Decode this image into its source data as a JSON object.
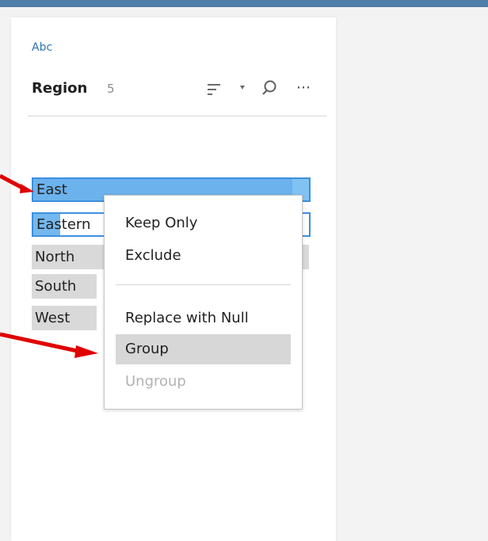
{
  "field": {
    "type_label": "Abc",
    "name": "Region",
    "count": "5"
  },
  "toolbar_icons": [
    "sort-icon",
    "chevron-down-icon",
    "search-icon",
    "more-icon"
  ],
  "values": [
    {
      "label": "East",
      "selected": true
    },
    {
      "label": "Eastern",
      "selected": true
    },
    {
      "label": "North",
      "selected": false
    },
    {
      "label": "South",
      "selected": false
    },
    {
      "label": "West",
      "selected": false
    }
  ],
  "context_menu": {
    "items": [
      {
        "label": "Keep Only",
        "enabled": true
      },
      {
        "label": "Exclude",
        "enabled": true
      },
      {
        "label": "Replace with Null",
        "enabled": true
      },
      {
        "label": "Group",
        "enabled": true,
        "highlighted": true
      },
      {
        "label": "Ungroup",
        "enabled": false
      }
    ]
  },
  "colors": {
    "accent": "#2f76b6",
    "selection_border": "#3d8fde",
    "selection_fill": "#80c3f2",
    "annotation_arrow": "#e00000",
    "menu_highlight": "#d7d7d7"
  }
}
